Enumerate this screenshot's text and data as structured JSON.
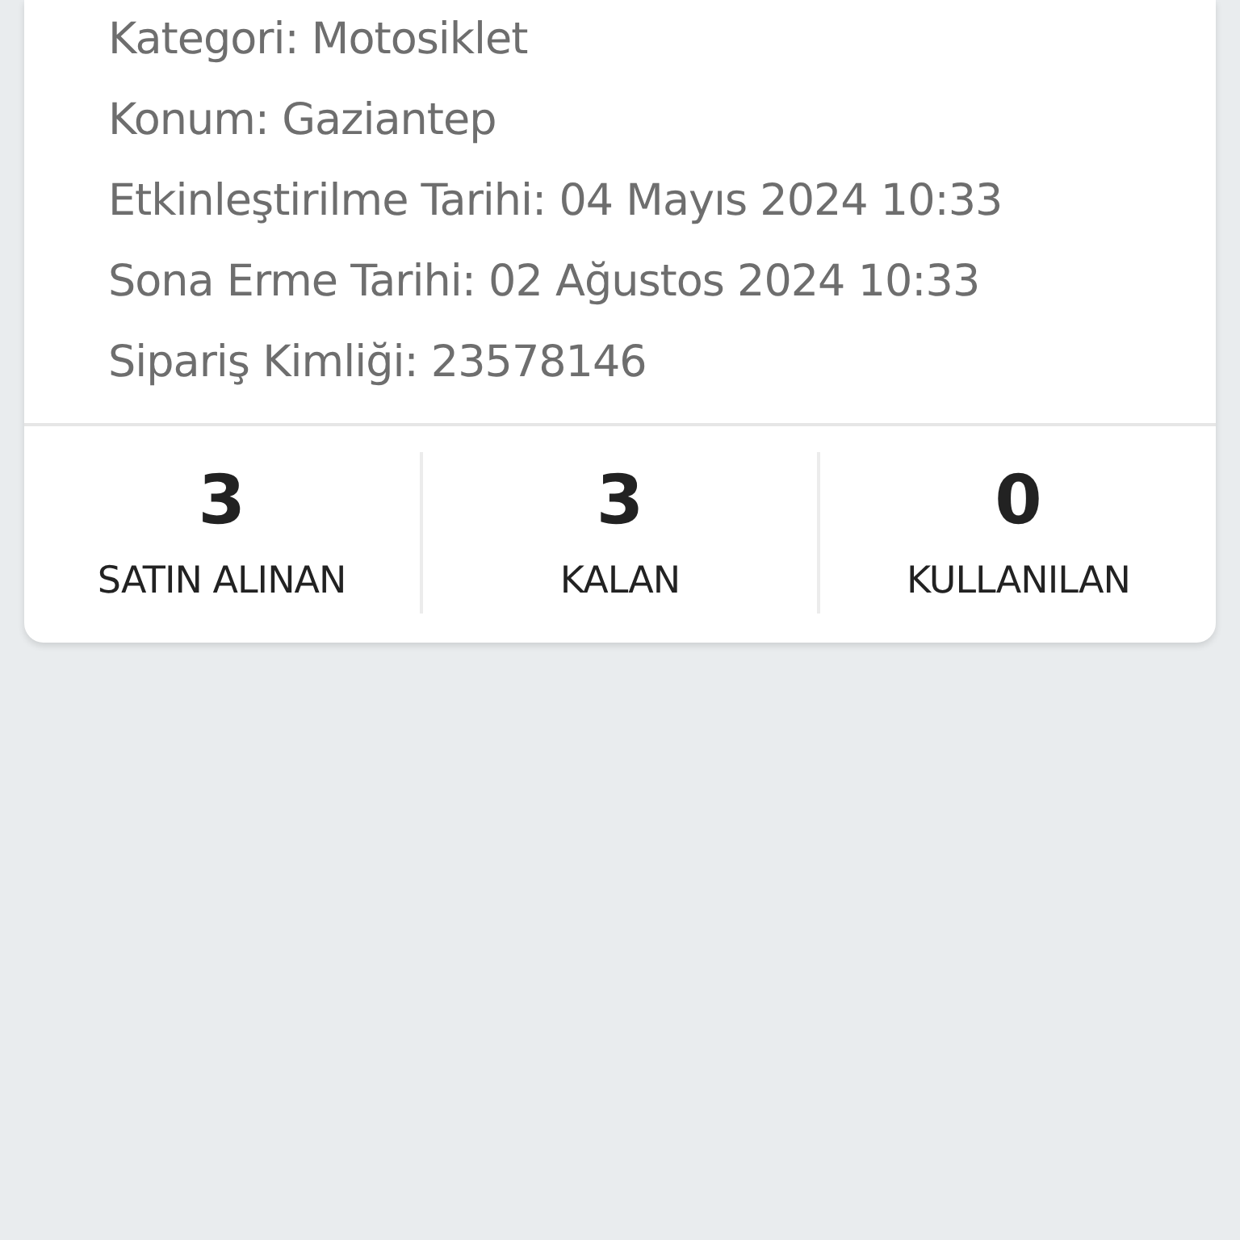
{
  "details": [
    "Kategori: Motosiklet",
    "Konum: Gaziantep",
    "Etkinleştirilme Tarihi: 04 Mayıs 2024 10:33",
    "Sona Erme Tarihi: 02 Ağustos 2024 10:33",
    "Sipariş Kimliği: 23578146"
  ],
  "stats": [
    {
      "value": "3",
      "label": "SATIN ALINAN"
    },
    {
      "value": "3",
      "label": "KALAN"
    },
    {
      "value": "0",
      "label": "KULLANILAN"
    }
  ]
}
